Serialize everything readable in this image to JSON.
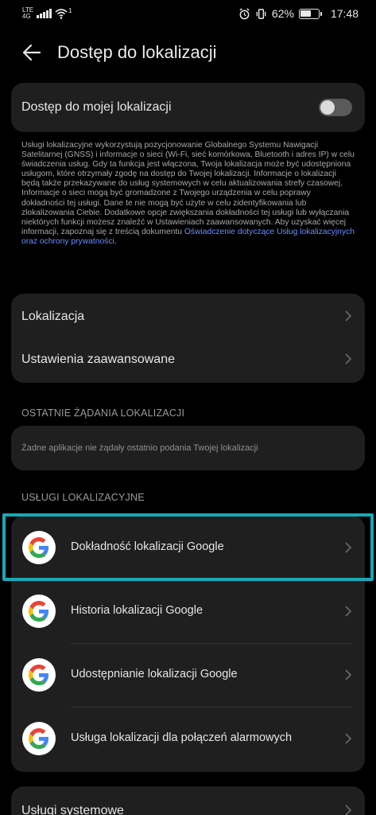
{
  "status": {
    "network": "LTE",
    "network_sub": "4G",
    "wifi_sup": "1",
    "battery": "62%",
    "time": "17:48"
  },
  "header": {
    "title": "Dostęp do lokalizacji",
    "back_icon": "arrow-left-icon"
  },
  "my_location": {
    "label": "Dostęp do mojej lokalizacji",
    "toggle_on": false
  },
  "description": {
    "text": "Usługi lokalizacyjne wykorzystują pozycjonowanie Globalnego Systemu Nawigacji Satelitarnej (GNSS) i informacje o sieci (Wi-Fi, sieć komórkowa, Bluetooth i adres IP) w celu świadczenia usług. Gdy ta funkcja jest włączona, Twoja lokalizacja może być udostępniona usługom, które otrzymały zgodę na dostęp do Twojej lokalizacji. Informacje o lokalizacji będą także przekazywane do usług systemowych w celu aktualizowania strefy czasowej. Informacje o sieci mogą być gromadzone z Twojego urządzenia w celu poprawy dokładności tej usługi. Dane te nie mogą być użyte w celu zidentyfikowania lub zlokalizowania Ciebie. Dodatkowe opcje zwiększania dokładności tej usługi lub wyłączania niektórych funkcji możesz znaleźć w Ustawieniach zaawansowanych. Aby uzyskać więcej informacji, zapoznaj się z treścią dokumentu ",
    "link": "Oświadczenie dotyczące Usług lokalizacyjnych oraz ochrony prywatności",
    "end": "."
  },
  "settings_items": [
    {
      "label": "Lokalizacja"
    },
    {
      "label": "Ustawienia zaawansowane"
    }
  ],
  "recent_requests": {
    "section_title": "OSTATNIE ŻĄDANIA LOKALIZACJI",
    "empty_text": "Żadne aplikacje nie żądały ostatnio podania Twojej lokalizacji"
  },
  "location_services": {
    "section_title": "USŁUGI LOKALIZACYJNE",
    "items": [
      {
        "label": "Dokładność lokalizacji Google",
        "icon": "google-icon"
      },
      {
        "label": "Historia lokalizacji Google",
        "icon": "google-icon"
      },
      {
        "label": "Udostępnianie lokalizacji Google",
        "icon": "google-icon"
      },
      {
        "label": "Usługa lokalizacji dla połączeń alarmowych",
        "icon": "google-icon"
      }
    ]
  },
  "system_services": {
    "label": "Usługi systemowe"
  },
  "colors": {
    "background": "#000000",
    "card": "#1f1f1f",
    "link": "#6b8cff",
    "highlight": "#1aa8b8"
  }
}
